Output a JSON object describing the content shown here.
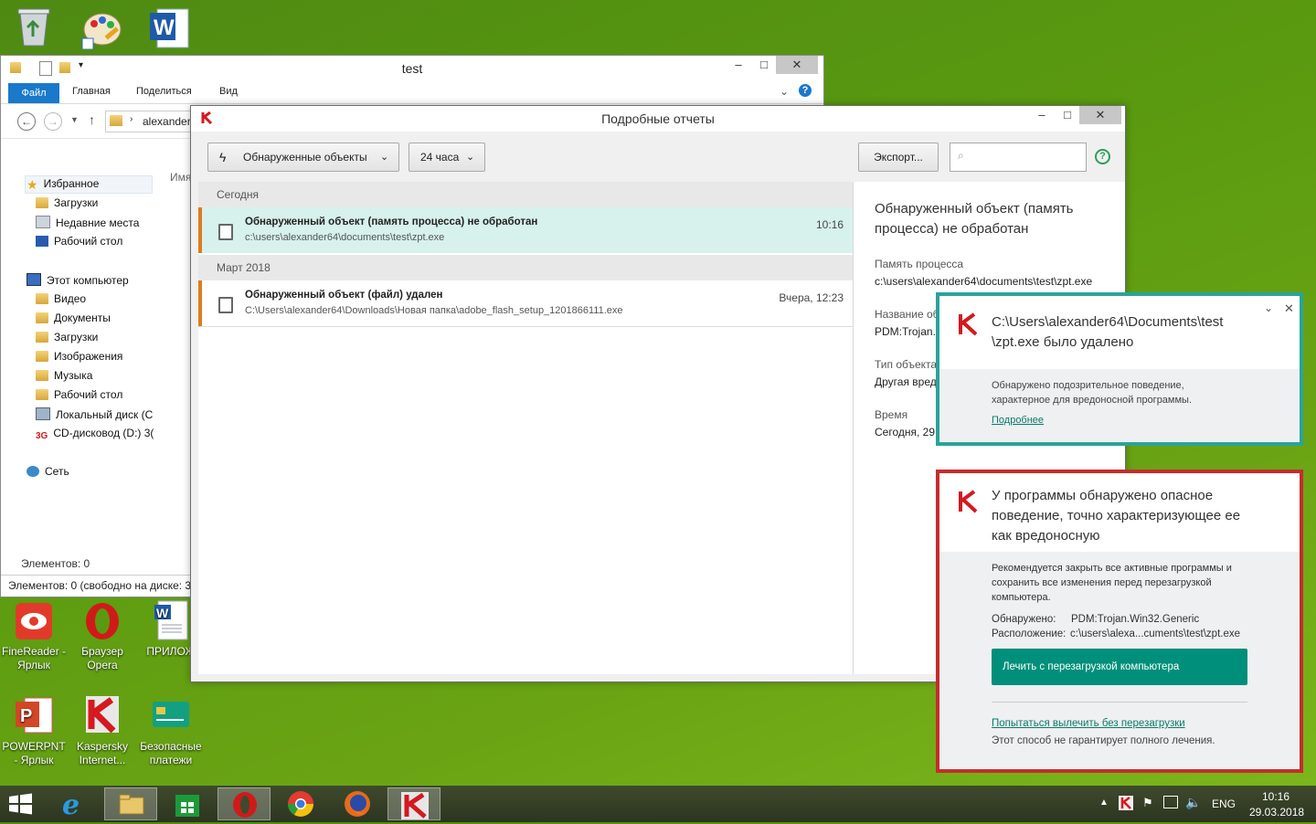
{
  "colors": {
    "kaspersky_red": "#d4191f",
    "kaspersky_green": "#009982",
    "selected_row": "#d7f1ec",
    "orange_marker": "#e07b1c",
    "teal_border": "#2aa39a",
    "red_border": "#c72c2c"
  },
  "desktop": {
    "icons": [
      {
        "label": "FineReader - Ярлык"
      },
      {
        "label": "Браузер Opera"
      },
      {
        "label": "ПРИЛОЖ"
      },
      {
        "label": "POWERPNT - Ярлык"
      },
      {
        "label": "Kaspersky Internet..."
      },
      {
        "label": "Безопасные платежи"
      }
    ]
  },
  "explorer": {
    "title": "test",
    "ribbon": {
      "file": "Файл",
      "home": "Главная",
      "share": "Поделиться",
      "view": "Вид"
    },
    "address": "alexander6",
    "column_header": "Имя",
    "nav": {
      "favorites": "Избранное",
      "downloads": "Загрузки",
      "recent": "Недавние места",
      "desktop": "Рабочий стол",
      "this_pc": "Этот компьютер",
      "video": "Видео",
      "documents": "Документы",
      "downloads2": "Загрузки",
      "images": "Изображения",
      "music": "Музыка",
      "desktop2": "Рабочий стол",
      "local_disk": "Локальный диск (С",
      "cd_drive": "CD-дисковод (D:) 3(",
      "network": "Сеть"
    },
    "items_count": "Элементов: 0",
    "status": "Элементов: 0 (свободно на диске: 33"
  },
  "reports": {
    "title": "Подробные отчеты",
    "filter_label": "Обнаруженные объекты",
    "period_label": "24 часа",
    "export_label": "Экспорт...",
    "search_placeholder": "",
    "sections": [
      {
        "label": "Сегодня"
      },
      {
        "label": "Март 2018"
      }
    ],
    "rows": [
      {
        "title": "Обнаруженный объект (память процесса) не обработан",
        "path": "c:\\users\\alexander64\\documents\\test\\zpt.exe",
        "time": "10:16"
      },
      {
        "title": "Обнаруженный объект (файл) удален",
        "path": "C:\\Users\\alexander64\\Downloads\\Новая папка\\adobe_flash_setup_1201866111.exe",
        "time": "Вчера, 12:23"
      }
    ],
    "detail": {
      "heading": "Обнаруженный объект (память процесса) не обработан",
      "label1": "Память процесса",
      "val1": "c:\\users\\alexander64\\documents\\test\\zpt.exe",
      "label2": "Название об",
      "val2": "PDM:Trojan.\\",
      "label3": "Тип объекта",
      "val3": "Другая вред",
      "label4": "Время",
      "val4": "Сегодня, 29.("
    }
  },
  "popup1": {
    "title": "C:\\Users\\alexander64\\Documents\\test \\zpt.exe было удалено",
    "body": "Обнаружено подозрительное поведение, характерное для вредоносной программы.",
    "link": "Подробнее"
  },
  "popup2": {
    "title": "У программы обнаружено опасное поведение, точно характеризующее ее как вредоносную",
    "body": "Рекомендуется закрыть все активные программы и сохранить все изменения перед перезагрузкой компьютера.",
    "detected_label": "Обнаружено:",
    "detected_value": "PDM:Trojan.Win32.Generic",
    "location_label": "Расположение:",
    "location_value": "c:\\users\\alexa...cuments\\test\\zpt.exe",
    "primary_button": "Лечить с перезагрузкой компьютера",
    "alt_link": "Попытаться вылечить без перезагрузки",
    "note": "Этот способ не гарантирует полного лечения."
  },
  "taskbar": {
    "lang": "ENG",
    "time": "10:16",
    "date": "29.03.2018"
  }
}
